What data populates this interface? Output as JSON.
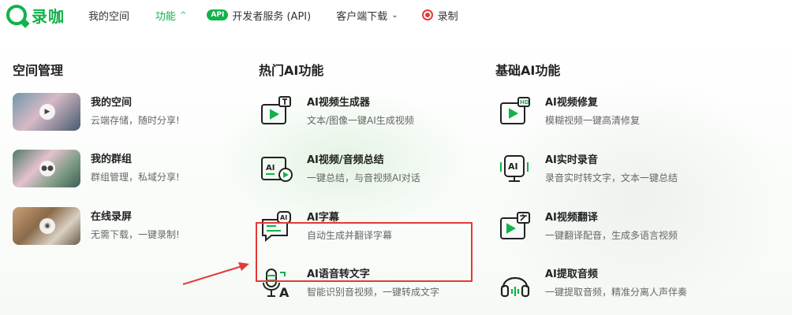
{
  "nav": {
    "logo_text": "录咖",
    "items": [
      {
        "label": "我的空间"
      },
      {
        "label": "功能"
      },
      {
        "badge": "API",
        "label": "开发者服务 (API)"
      },
      {
        "label": "客户端下载"
      },
      {
        "label": "录制"
      }
    ]
  },
  "columns": {
    "space": {
      "title": "空间管理",
      "items": [
        {
          "title": "我的空间",
          "desc": "云端存储，随时分享!"
        },
        {
          "title": "我的群组",
          "desc": "群组管理，私域分享!"
        },
        {
          "title": "在线录屏",
          "desc": "无需下载，一键录制!"
        }
      ]
    },
    "hot": {
      "title": "热门AI功能",
      "items": [
        {
          "title": "AI视频生成器",
          "desc": "文本/图像一键AI生成视频",
          "icon": "video-generate-icon"
        },
        {
          "title": "AI视频/音频总结",
          "desc": "一键总结，与音视频AI对话",
          "icon": "ai-summary-icon"
        },
        {
          "title": "AI字幕",
          "desc": "自动生成并翻译字幕",
          "icon": "ai-subtitle-icon"
        },
        {
          "title": "AI语音转文字",
          "desc": "智能识别音视频，一键转成文字",
          "icon": "speech-to-text-icon"
        }
      ]
    },
    "basic": {
      "title": "基础AI功能",
      "items": [
        {
          "title": "AI视频修复",
          "desc": "模糊视频一键高清修复",
          "icon": "hd-repair-icon"
        },
        {
          "title": "AI实时录音",
          "desc": "录音实时转文字，文本一键总结",
          "icon": "realtime-record-icon"
        },
        {
          "title": "AI视频翻译",
          "desc": "一键翻译配音，生成多语言视频",
          "icon": "video-translate-icon"
        },
        {
          "title": "AI提取音频",
          "desc": "一键提取音频，精准分离人声伴奏",
          "icon": "headphones-icon"
        }
      ]
    }
  },
  "colors": {
    "brand": "#12b34a",
    "highlight": "#e53935",
    "record": "#e23b3b"
  }
}
